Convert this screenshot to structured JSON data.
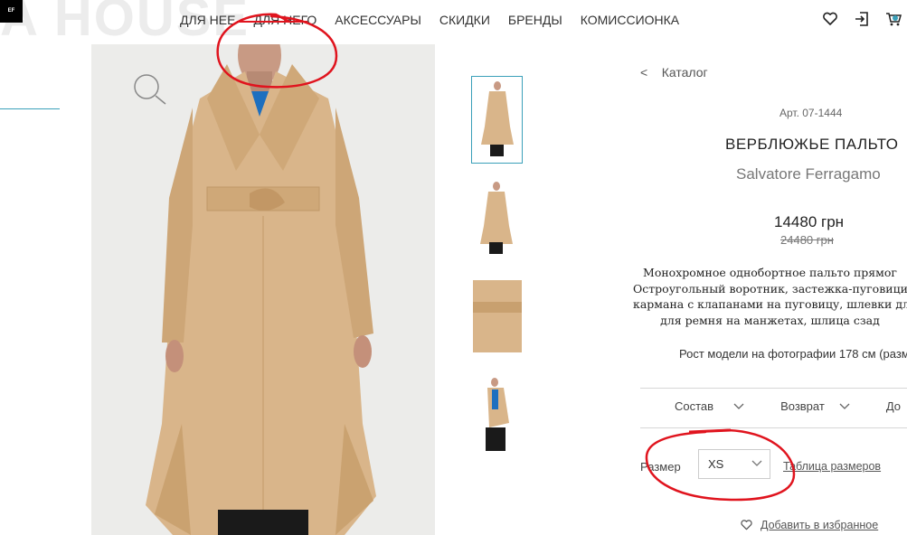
{
  "header": {
    "logo_bg_text": "A HOUSE",
    "logo_box_text": "EF",
    "nav": [
      "ДЛЯ НЕЕ",
      "ДЛЯ НЕГО",
      "АКСЕССУАРЫ",
      "СКИДКИ",
      "БРЕНДЫ",
      "КОМИССИОНКА"
    ],
    "icons": [
      "heart-icon",
      "login-icon",
      "cart-icon"
    ]
  },
  "product": {
    "back_arrow": "<",
    "back_label": "Каталог",
    "article": "Арт. 07-1444",
    "title": "ВЕРБЛЮЖЬЕ ПАЛЬТО",
    "brand": "Salvatore Ferragamo",
    "price": "14480 грн",
    "old_price": "24480 грн",
    "description_lines": [
      "Монохромное однобортное пальто прямог",
      "Остроугольный воротник, застежка-пуговици,",
      "кармана с клапанами на пуговицу, шлевки для р",
      "для ремня на манжетах, шлица сзад"
    ],
    "model_height": "Рост модели на фотографии 178 см (разм",
    "tabs": [
      "Состав",
      "Возврат",
      "До"
    ],
    "size_label": "Размер",
    "size_value": "XS",
    "size_table": "Таблица размеров",
    "favorite": "Добавить в избранное"
  },
  "colors": {
    "accent": "#3aa0b9",
    "coat": "#d9b58a",
    "annotation": "#e0141e"
  }
}
